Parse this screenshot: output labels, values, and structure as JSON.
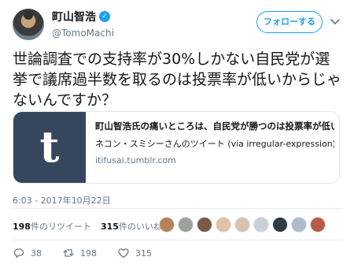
{
  "author": {
    "display_name": "町山智浩",
    "handle": "@TomoMachi",
    "verified_badge": "✓"
  },
  "follow_button": {
    "label": "フォローする"
  },
  "tweet": {
    "text": "世論調査での支持率が30%しかない自民党が選挙で議席過半数を取るのは投票率が低いからじゃないんですか？"
  },
  "card": {
    "thumb_glyph": "t",
    "title": "町山智浩氏の痛いところは、自民党が勝つのは投票率が低いか…",
    "description": "ネコン・スミシーさんのツイート (via irregular-expression)",
    "domain": "itifusai.tumblr.com"
  },
  "timestamp": "6:03 - 2017年10月22日",
  "stats": {
    "retweets_count": "198",
    "retweets_label": "件のリツイート",
    "likes_count": "315",
    "likes_label": "件のいいね"
  },
  "liker_faces": [
    {
      "color": "#b7825a"
    },
    {
      "color": "#9aa39a"
    },
    {
      "color": "#7a5a44"
    },
    {
      "color": "#e0c2a8"
    },
    {
      "color": "#d9c1b2"
    },
    {
      "color": "#c7d0d8"
    },
    {
      "color": "#2f3b45"
    },
    {
      "color": "#aebbc7"
    },
    {
      "color": "#b85a4a"
    }
  ],
  "actions": {
    "reply_count": "38",
    "retweet_count": "198",
    "like_count": "315"
  },
  "colors": {
    "accent": "#1da1f2",
    "text_secondary": "#657786",
    "tumblr_blue": "#36465d"
  },
  "icons": {
    "verified": "verified-badge-icon",
    "chevron": "chevron-down-icon",
    "reply": "reply-icon",
    "retweet": "retweet-icon",
    "like": "heart-icon"
  }
}
